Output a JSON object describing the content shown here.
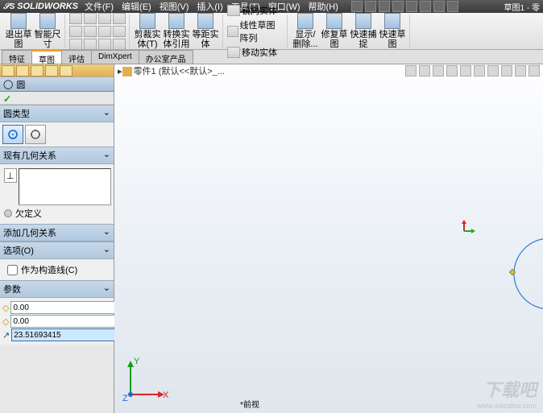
{
  "app": {
    "name": "SOLIDWORKS",
    "doc_title": "草图1 - 零"
  },
  "menus": [
    "文件(F)",
    "编辑(E)",
    "视图(V)",
    "插入(I)",
    "工具(T)",
    "窗口(W)",
    "帮助(H)"
  ],
  "ribbon": {
    "big": [
      {
        "label": "退出草\n图"
      },
      {
        "label": "智能尺\n寸"
      },
      {
        "label": "剪裁实\n体(T)"
      },
      {
        "label": "转换实\n体引用"
      },
      {
        "label": "等距实\n体"
      },
      {
        "label": "镜向实体"
      },
      {
        "label": "线性草图阵列"
      },
      {
        "label": "移动实体"
      },
      {
        "label": "显示/\n删除..."
      },
      {
        "label": "修复草\n图"
      },
      {
        "label": "快速捕\n捉"
      },
      {
        "label": "快速草\n图"
      }
    ]
  },
  "tabs": [
    "特征",
    "草图",
    "评估",
    "DimXpert",
    "办公室产品"
  ],
  "active_tab": 1,
  "breadcrumb": "零件1 (默认<<默认>_...",
  "pm": {
    "title": "圆",
    "sections": {
      "type": "圆类型",
      "existing": "现有几何关系",
      "status": "欠定义",
      "add": "添加几何关系",
      "options": "选项(O)",
      "construction": "作为构造线(C)",
      "params": "参数"
    },
    "params": {
      "cx": "0.00",
      "cy": "0.00",
      "r": "23.51693415"
    }
  },
  "view_label": "*前视",
  "watermark": "下载吧",
  "watermark_url": "www.xiazaiba.com",
  "chart_data": {
    "type": "sketch",
    "entity": "circle",
    "center": [
      0.0,
      0.0
    ],
    "radius": 23.51693415,
    "definition_state": "under_defined"
  }
}
